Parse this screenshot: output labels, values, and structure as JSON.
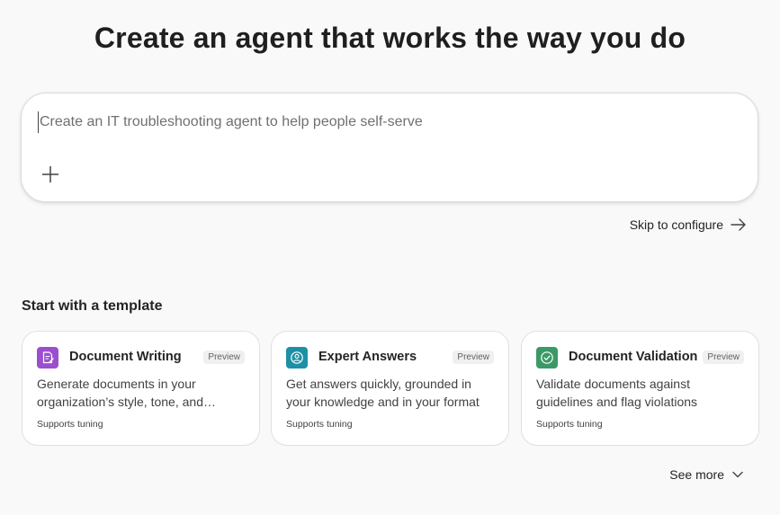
{
  "header": {
    "title": "Create an agent that works the way you do"
  },
  "prompt": {
    "value": "",
    "placeholder": "Create an IT troubleshooting agent to help people self-serve",
    "add_icon": "plus-icon"
  },
  "skip": {
    "label": "Skip to configure",
    "icon": "arrow-right-icon"
  },
  "templates": {
    "heading": "Start with a template",
    "cards": [
      {
        "title": "Document Writing",
        "badge": "Preview",
        "description": "Generate documents in your organization’s style, tone, and…",
        "tag": "Supports tuning",
        "icon": "document-edit-icon",
        "color": "#9b4fcf"
      },
      {
        "title": "Expert Answers",
        "badge": "Preview",
        "description": "Get answers quickly, grounded in your knowledge and in your format",
        "tag": "Supports tuning",
        "icon": "person-circle-icon",
        "color": "#1e90a6"
      },
      {
        "title": "Document Validation",
        "badge": "Preview",
        "description": "Validate documents against guidelines and flag violations",
        "tag": "Supports tuning",
        "icon": "check-circle-icon",
        "color": "#3a9a67"
      }
    ],
    "see_more": {
      "label": "See more",
      "icon": "chevron-down-icon"
    }
  }
}
